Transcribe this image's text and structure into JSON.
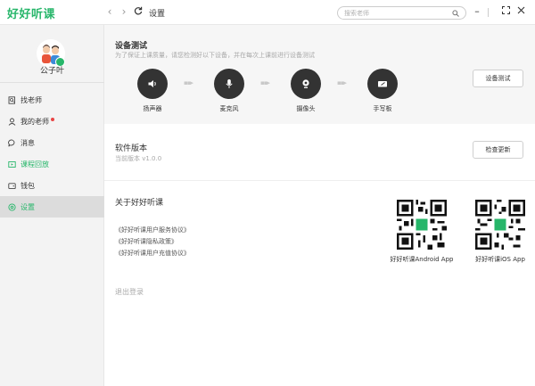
{
  "app": {
    "logo": "好好听课",
    "page_title": "设置"
  },
  "search": {
    "placeholder": "搜索老师"
  },
  "user": {
    "name": "公子叶"
  },
  "sidebar": {
    "items": [
      {
        "label": "找老师"
      },
      {
        "label": "我的老师"
      },
      {
        "label": "消息"
      },
      {
        "label": "课程回放"
      },
      {
        "label": "钱包"
      },
      {
        "label": "设置"
      }
    ]
  },
  "device_test": {
    "title": "设备测试",
    "subtitle": "为了保证上课质量，请您检测好以下设备，并在每次上课前进行设备测试",
    "button": "设备测试",
    "devices": [
      {
        "label": "扬声器",
        "icon": "speaker-icon"
      },
      {
        "label": "麦克风",
        "icon": "microphone-icon"
      },
      {
        "label": "摄像头",
        "icon": "camera-icon"
      },
      {
        "label": "手写板",
        "icon": "tablet-icon"
      }
    ]
  },
  "software": {
    "title": "软件版本",
    "version": "当前版本 v1.0.0",
    "button": "检查更新"
  },
  "about": {
    "title": "关于好好听课",
    "links": [
      "《好好听课用户服务协议》",
      "《好好听课隐私政策》",
      "《好好听课用户充值协议》"
    ],
    "qr_android": "好好听课Android App",
    "qr_ios": "好好听课iOS App"
  },
  "logout": "退出登录",
  "colors": {
    "accent": "#27b66a",
    "device_circle": "#333333",
    "badge": "#e84545"
  }
}
